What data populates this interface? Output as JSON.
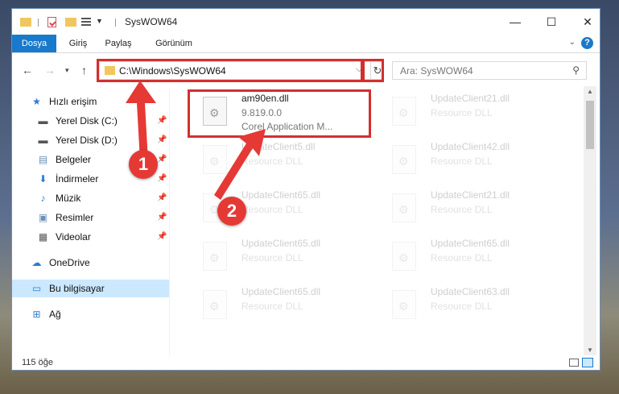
{
  "window": {
    "title": "SysWOW64"
  },
  "ribbon": {
    "tabs": [
      "Dosya",
      "Giriş",
      "Paylaş",
      "Görünüm"
    ],
    "help": "?"
  },
  "address": {
    "path": "C:\\Windows\\SysWOW64"
  },
  "search": {
    "placeholder": "Ara: SysWOW64"
  },
  "nav": {
    "items": [
      {
        "label": "Hızlı erişim",
        "icon": "star-icon"
      },
      {
        "label": "Yerel Disk (C:)",
        "icon": "drive-icon"
      },
      {
        "label": "Yerel Disk (D:)",
        "icon": "drive-icon"
      },
      {
        "label": "Belgeler",
        "icon": "documents-icon"
      },
      {
        "label": "İndirmeler",
        "icon": "download-icon"
      },
      {
        "label": "Müzik",
        "icon": "music-icon"
      },
      {
        "label": "Resimler",
        "icon": "pictures-icon"
      },
      {
        "label": "Videolar",
        "icon": "videos-icon"
      },
      {
        "label": "OneDrive",
        "icon": "cloud-icon"
      },
      {
        "label": "Bu bilgisayar",
        "icon": "computer-icon"
      },
      {
        "label": "Ağ",
        "icon": "network-icon"
      }
    ]
  },
  "files": [
    {
      "name": "am90en.dll",
      "version": "9.819.0.0",
      "description": "Corel Application M..."
    },
    {
      "name": "UpdateClient21.dll",
      "description": "Resource DLL"
    },
    {
      "name": "UpdateClient5.dll",
      "description": "Resource DLL"
    },
    {
      "name": "UpdateClient42.dll",
      "description": "Resource DLL"
    },
    {
      "name": "UpdateClient65.dll",
      "description": "Resource DLL"
    },
    {
      "name": "UpdateClient21.dll",
      "description": "Resource DLL"
    },
    {
      "name": "UpdateClient65.dll",
      "description": "Resource DLL"
    },
    {
      "name": "UpdateClient65.dll",
      "description": "Resource DLL"
    },
    {
      "name": "UpdateClient65.dll",
      "description": "Resource DLL"
    },
    {
      "name": "UpdateClient63.dll",
      "description": "Resource DLL"
    }
  ],
  "status": {
    "count": "115 öğe"
  },
  "annotations": {
    "badge1": "1",
    "badge2": "2",
    "color": "#e53935"
  }
}
